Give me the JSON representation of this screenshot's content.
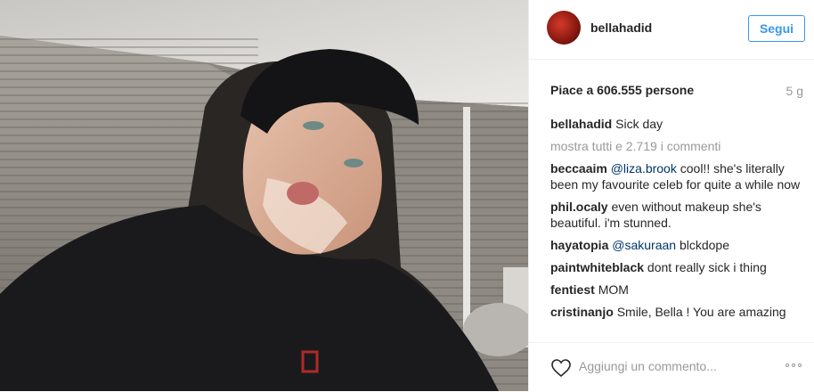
{
  "header": {
    "username": "bellahadid",
    "follow_label": "Segui",
    "avatar_icon": "profile-avatar"
  },
  "stats": {
    "likes": "Piace a 606.555 persone",
    "age": "5 g"
  },
  "caption": {
    "username": "bellahadid",
    "text": "Sick day"
  },
  "more_comments": "mostra tutti e 2.719 i commenti",
  "comments": [
    {
      "username": "beccaaim",
      "mention": "@liza.brook",
      "text": " cool!! she's literally been my favourite celeb for quite a while now"
    },
    {
      "username": "phil.ocaly",
      "mention": "",
      "text": "even without makeup she's beautiful. i'm stunned."
    },
    {
      "username": "hayatopia",
      "mention": "@sakuraan",
      "text": " blckdope"
    },
    {
      "username": "paintwhiteblack",
      "mention": "",
      "text": "dont really sick i thing"
    },
    {
      "username": "fentiest",
      "mention": "",
      "text": "MOM"
    },
    {
      "username": "cristinanjo",
      "mention": "",
      "text": "Smile, Bella ! You are amazing"
    }
  ],
  "footer": {
    "comment_placeholder": "Aggiungi un commento...",
    "like_icon": "heart-outline",
    "options_icon": "more-options"
  },
  "colors": {
    "accent": "#3897f0",
    "mention": "#003569",
    "muted": "#999999",
    "text": "#262626"
  }
}
